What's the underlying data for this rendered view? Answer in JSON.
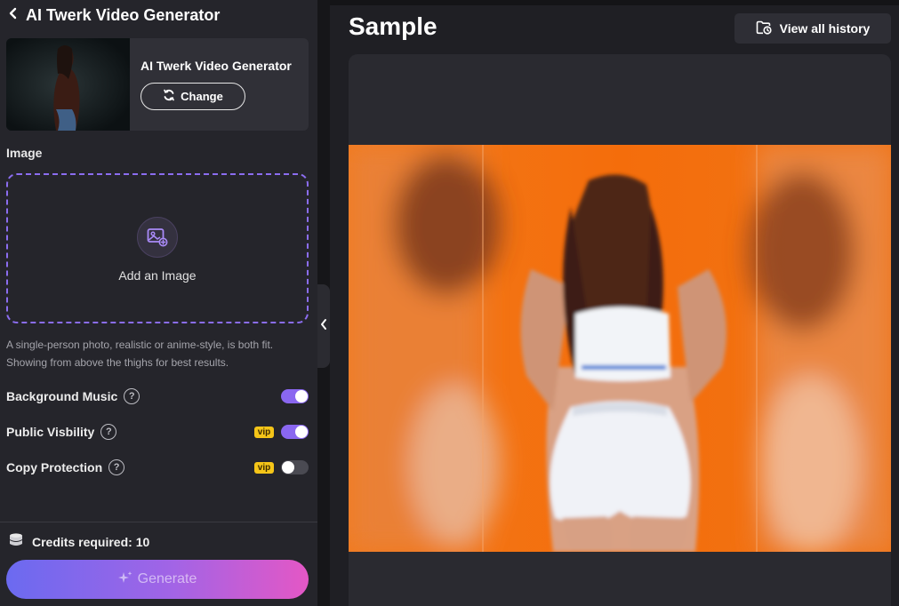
{
  "panel": {
    "header": {
      "back_icon": "chevron-left-icon",
      "title": "AI Twerk Video Generator"
    },
    "model_card": {
      "name": "AI Twerk Video Generator",
      "change_label": "Change",
      "change_icon": "refresh-icon"
    },
    "image_section": {
      "label": "Image",
      "upload_text": "Add an Image",
      "upload_icon": "image-add-icon",
      "hint": "A single-person photo, realistic or anime-style, is both fit. Showing from above the thighs for best results."
    },
    "options": [
      {
        "label": "Background Music",
        "vip": false,
        "on": true
      },
      {
        "label": "Public Visbility",
        "vip": true,
        "vip_label": "vip",
        "on": true
      },
      {
        "label": "Copy Protection",
        "vip": true,
        "vip_label": "vip",
        "on": false
      }
    ],
    "credits_text": "Credits required: 10",
    "credits_icon": "coins-stack-icon",
    "generate_label": "Generate",
    "generate_icon": "sparkle-icon"
  },
  "sample": {
    "title": "Sample",
    "history_label": "View all history",
    "history_icon": "folder-history-icon"
  },
  "colors": {
    "accent": "#8a67f0",
    "vip": "#f5c518",
    "panel_bg": "#25252b",
    "video_bg": "#f07216"
  }
}
